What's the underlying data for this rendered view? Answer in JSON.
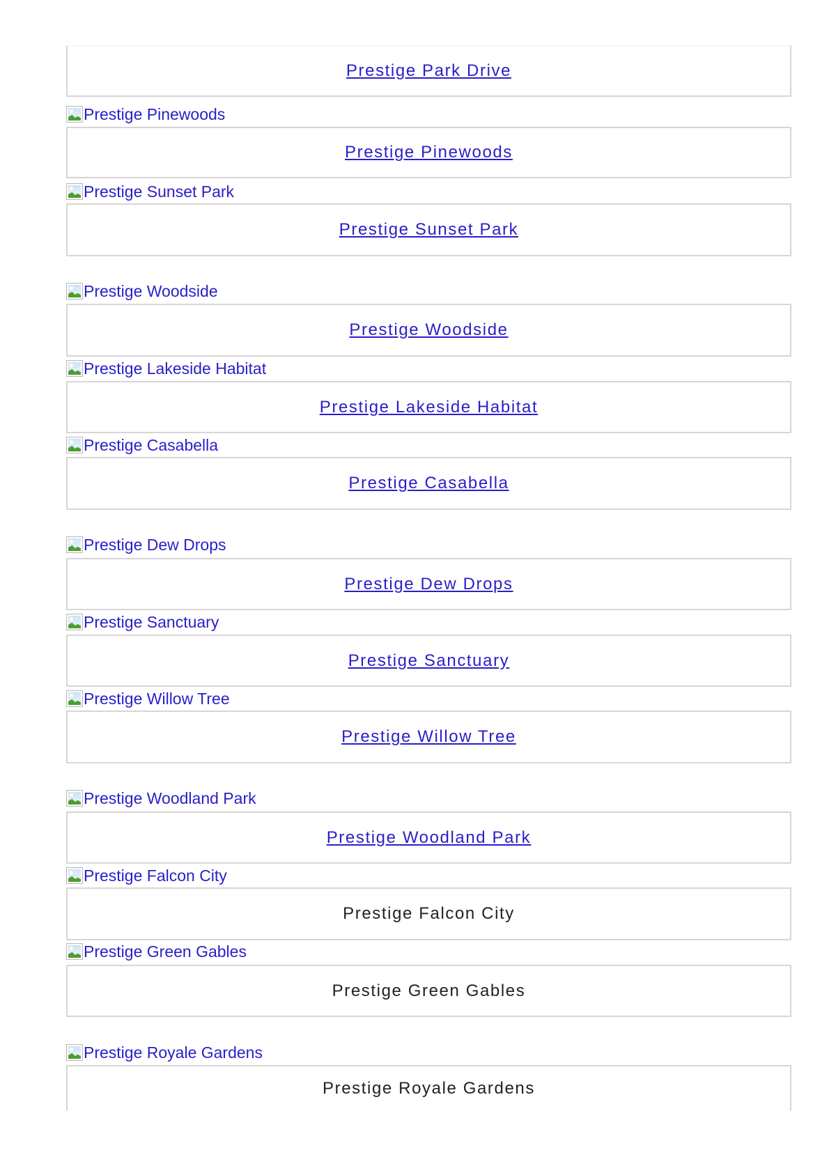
{
  "listings": [
    {
      "image_alt": "",
      "title": "Prestige Park Drive",
      "title_is_link": true
    },
    {
      "image_alt": "Prestige Pinewoods",
      "title": "Prestige Pinewoods",
      "title_is_link": true
    },
    {
      "image_alt": "Prestige Sunset Park",
      "title": "Prestige Sunset Park",
      "title_is_link": true
    },
    {
      "image_alt": "Prestige Woodside",
      "title": "Prestige Woodside",
      "title_is_link": true
    },
    {
      "image_alt": "Prestige Lakeside Habitat",
      "title": "Prestige Lakeside Habitat",
      "title_is_link": true
    },
    {
      "image_alt": "Prestige Casabella",
      "title": "Prestige Casabella",
      "title_is_link": true
    },
    {
      "image_alt": "Prestige Dew Drops",
      "title": "Prestige Dew Drops",
      "title_is_link": true
    },
    {
      "image_alt": "Prestige Sanctuary",
      "title": "Prestige Sanctuary",
      "title_is_link": true
    },
    {
      "image_alt": "Prestige Willow Tree",
      "title": "Prestige Willow Tree",
      "title_is_link": true
    },
    {
      "image_alt": "Prestige Woodland Park",
      "title": "Prestige Woodland Park",
      "title_is_link": true
    },
    {
      "image_alt": "Prestige Falcon City",
      "title": "Prestige Falcon City",
      "title_is_link": false
    },
    {
      "image_alt": "Prestige Green Gables",
      "title": "Prestige Green Gables",
      "title_is_link": false
    },
    {
      "image_alt": "Prestige Royale Gardens",
      "title": "Prestige Royale Gardens",
      "title_is_link": false
    }
  ],
  "colors": {
    "link": "#2a1fc8",
    "text": "#222222",
    "card_border": "#d6d6d6"
  },
  "icons": {
    "broken_image": "broken-image-icon"
  }
}
